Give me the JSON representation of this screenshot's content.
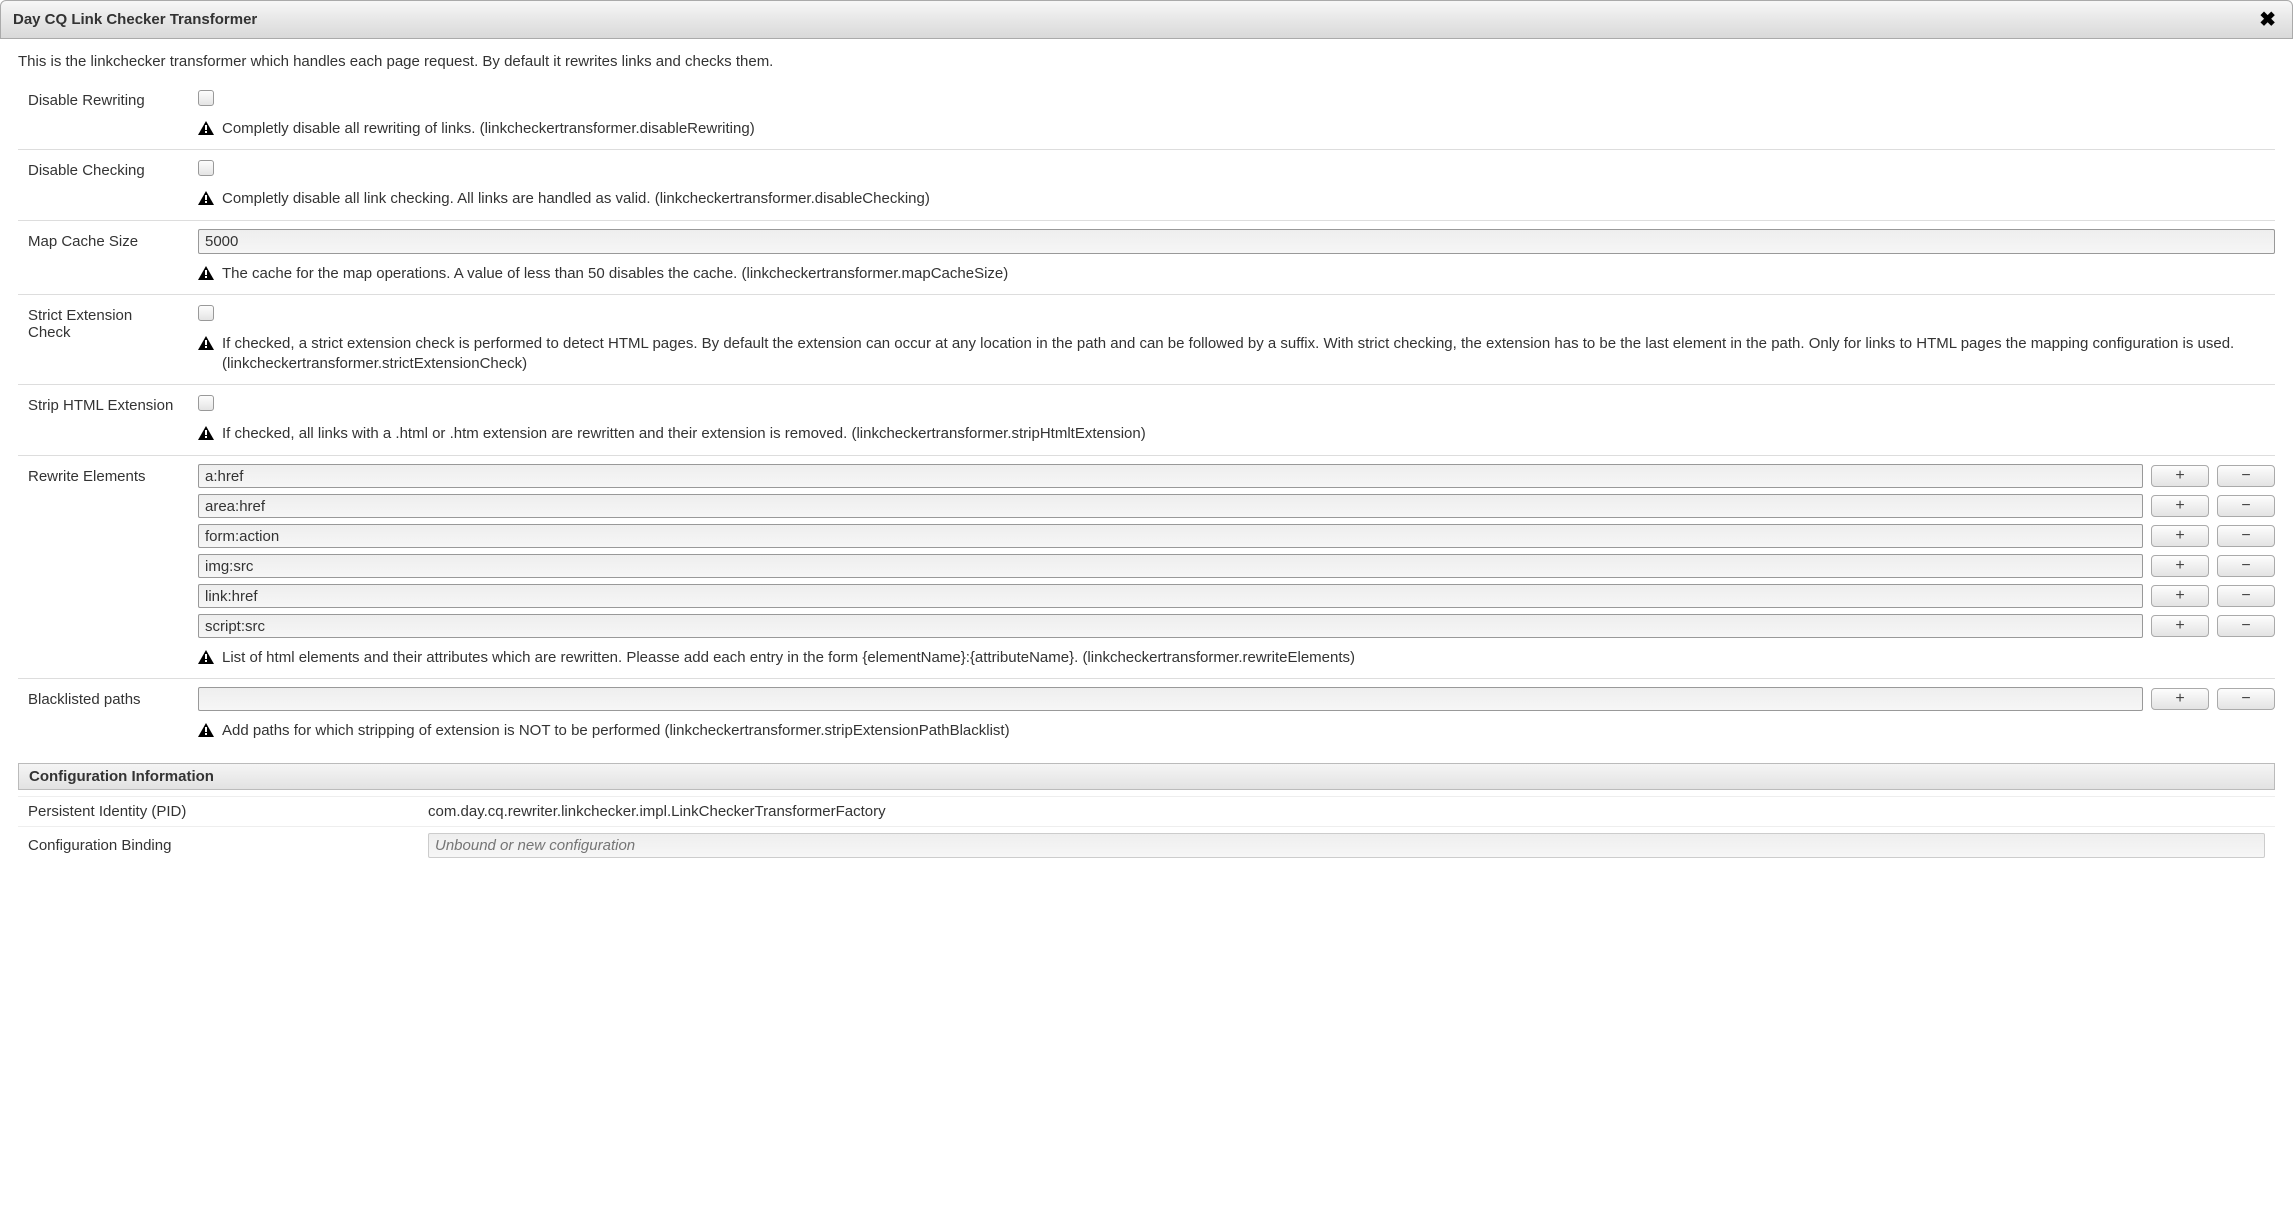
{
  "dialog": {
    "title": "Day CQ Link Checker Transformer",
    "description": "This is the linkchecker transformer which handles each page request. By default it rewrites links and checks them."
  },
  "fields": {
    "disableRewriting": {
      "label": "Disable Rewriting",
      "checked": false,
      "hint": "Completly disable all rewriting of links. (linkcheckertransformer.disableRewriting)"
    },
    "disableChecking": {
      "label": "Disable Checking",
      "checked": false,
      "hint": "Completly disable all link checking. All links are handled as valid. (linkcheckertransformer.disableChecking)"
    },
    "mapCacheSize": {
      "label": "Map Cache Size",
      "value": "5000",
      "hint": "The cache for the map operations. A value of less than 50 disables the cache. (linkcheckertransformer.mapCacheSize)"
    },
    "strictExtensionCheck": {
      "label": "Strict Extension Check",
      "checked": false,
      "hint": "If checked, a strict extension check is performed to detect HTML pages. By default the extension can occur at any location in the path and can be followed by a suffix. With strict checking, the extension has to be the last element in the path. Only for links to HTML pages the mapping configuration is used. (linkcheckertransformer.strictExtensionCheck)"
    },
    "stripHtmlExtension": {
      "label": "Strip HTML Extension",
      "checked": false,
      "hint": "If checked, all links with a .html or .htm extension are rewritten and their extension is removed. (linkcheckertransformer.stripHtmltExtension)"
    },
    "rewriteElements": {
      "label": "Rewrite Elements",
      "values": [
        "a:href",
        "area:href",
        "form:action",
        "img:src",
        "link:href",
        "script:src"
      ],
      "hint": "List of html elements and their attributes which are rewritten. Pleasse add each entry in the form {elementName}:{attributeName}. (linkcheckertransformer.rewriteElements)"
    },
    "blacklistedPaths": {
      "label": "Blacklisted paths",
      "values": [
        ""
      ],
      "hint": "Add paths for which stripping of extension is NOT to be performed (linkcheckertransformer.stripExtensionPathBlacklist)"
    }
  },
  "buttons": {
    "plus": "+",
    "minus": "−"
  },
  "configInfo": {
    "header": "Configuration Information",
    "pidLabel": "Persistent Identity (PID)",
    "pidValue": "com.day.cq.rewriter.linkchecker.impl.LinkCheckerTransformerFactory",
    "bindingLabel": "Configuration Binding",
    "bindingPlaceholder": "Unbound or new configuration"
  }
}
